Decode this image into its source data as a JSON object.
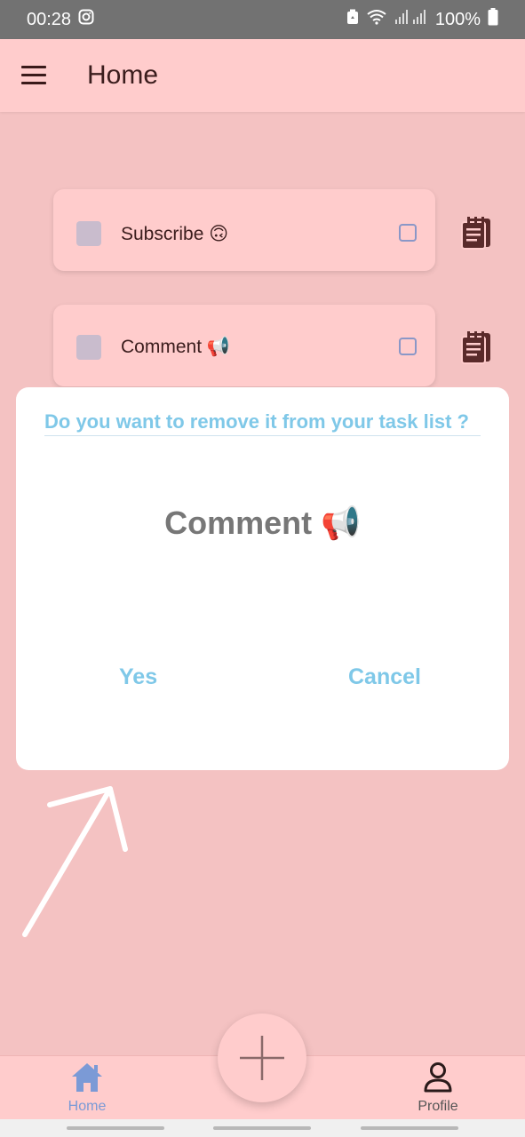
{
  "status_bar": {
    "time": "00:28",
    "battery": "100%",
    "icons": [
      "instagram-icon",
      "recycle-icon",
      "wifi-icon",
      "signal-icon",
      "battery-icon"
    ]
  },
  "app_bar": {
    "title": "Home",
    "menu_icon": "hamburger-menu-icon"
  },
  "tasks": [
    {
      "label": "Subscribe 🙃",
      "note_icon": "clipboard-note-icon"
    },
    {
      "label": "Comment 📢",
      "note_icon": "clipboard-note-icon"
    }
  ],
  "dialog": {
    "question": "Do you want to remove it from your task list ?",
    "item": "Comment 📢",
    "yes_label": "Yes",
    "cancel_label": "Cancel"
  },
  "bottom_nav": {
    "home_label": "Home",
    "profile_label": "Profile",
    "fab_icon": "plus-icon"
  },
  "colors": {
    "background": "#f4c2c2",
    "surface": "#ffcccc",
    "accent": "#7fc8e8",
    "nav_active": "#7b9ad6",
    "text_dark": "#3b1d1d"
  }
}
